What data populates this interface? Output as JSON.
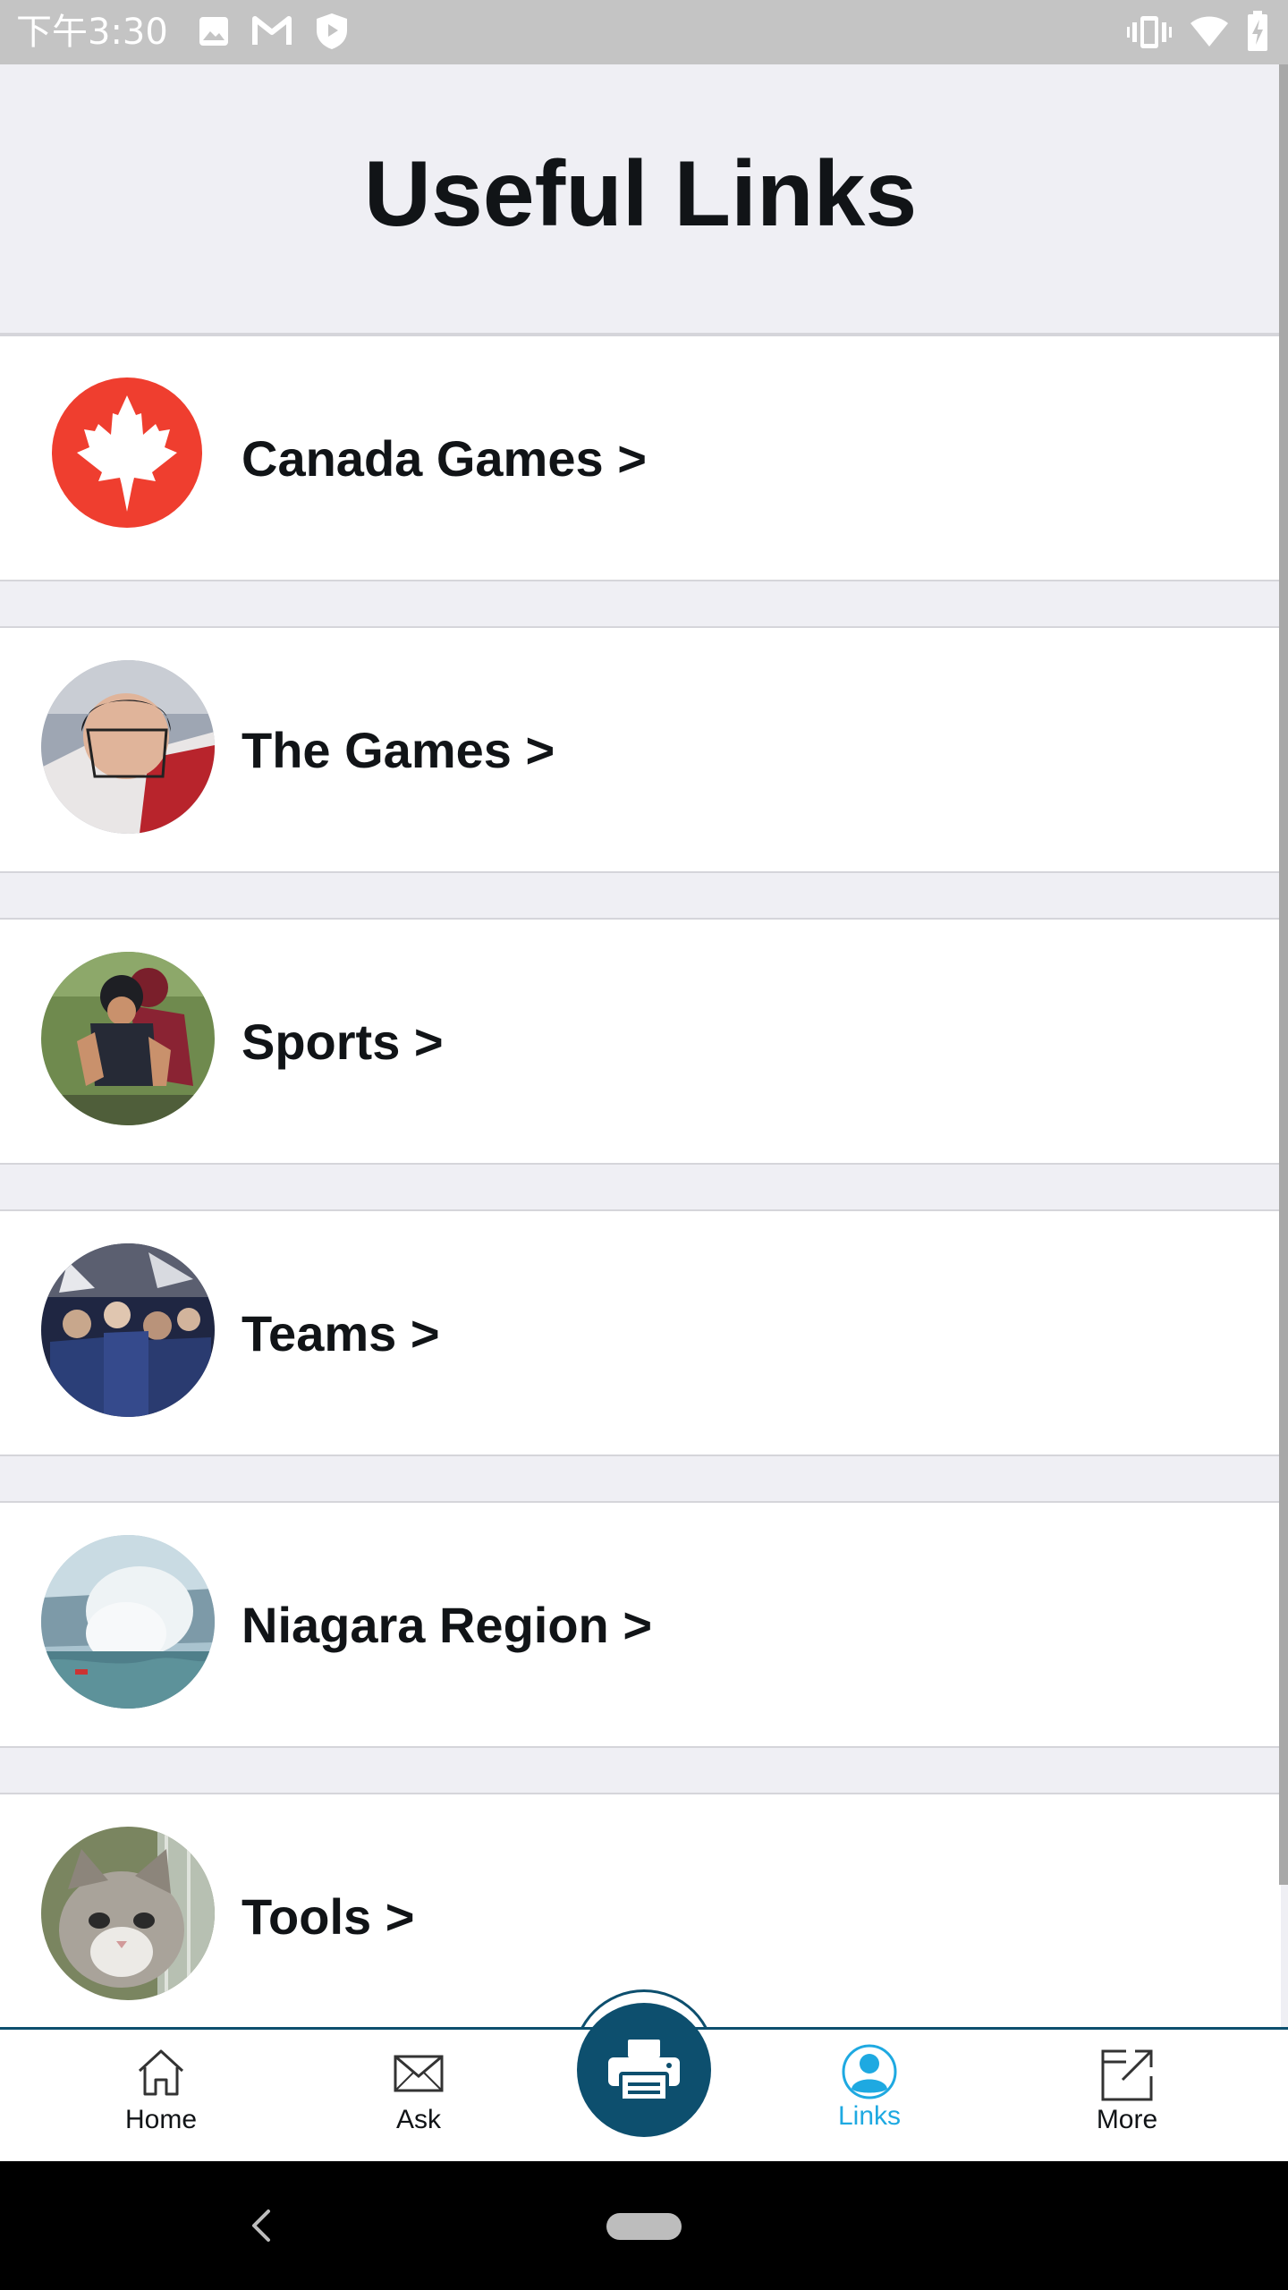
{
  "status_bar": {
    "time": "下午3:30",
    "icons": [
      "image-icon",
      "gmail-icon",
      "shield-play-icon",
      "vibrate-icon",
      "wifi-icon",
      "battery-icon"
    ]
  },
  "header": {
    "title": "Useful Links"
  },
  "list": {
    "items": [
      {
        "label": "Canada Games >",
        "icon": "maple-leaf-icon",
        "thumb_color": "#ef3e2f"
      },
      {
        "label": "The Games >",
        "icon": "hockey-player-photo",
        "thumb_color": "#8b8e94"
      },
      {
        "label": "Sports >",
        "icon": "cyclist-photo",
        "thumb_color": "#5d6b45"
      },
      {
        "label": "Teams >",
        "icon": "team-crowd-photo",
        "thumb_color": "#2a3350"
      },
      {
        "label": "Niagara Region >",
        "icon": "waterfall-photo",
        "thumb_color": "#9fbcc9"
      },
      {
        "label": "Tools >",
        "icon": "kitten-photo",
        "thumb_color": "#6f7a5a"
      }
    ]
  },
  "tabbar": {
    "tabs": [
      {
        "label": "Home",
        "icon": "home-icon"
      },
      {
        "label": "Ask",
        "icon": "envelope-icon"
      },
      {
        "label": "Links",
        "icon": "person-icon",
        "active": true
      },
      {
        "label": "More",
        "icon": "external-link-icon"
      }
    ],
    "fab_icon": "printer-icon"
  },
  "colors": {
    "accent": "#0d4f6e",
    "active_tab": "#1ea9e1",
    "brand_red": "#ef3e2f",
    "background": "#efeff4"
  }
}
